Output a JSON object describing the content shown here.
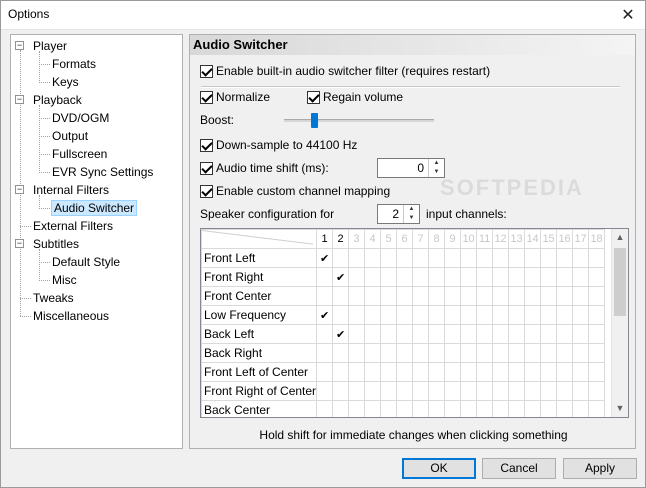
{
  "window": {
    "title": "Options",
    "close_glyph": "✕"
  },
  "tree": {
    "items": [
      {
        "label": "Player",
        "level": 0,
        "expand": "−"
      },
      {
        "label": "Formats",
        "level": 1
      },
      {
        "label": "Keys",
        "level": 1
      },
      {
        "label": "Playback",
        "level": 0,
        "expand": "−"
      },
      {
        "label": "DVD/OGM",
        "level": 1
      },
      {
        "label": "Output",
        "level": 1
      },
      {
        "label": "Fullscreen",
        "level": 1
      },
      {
        "label": "EVR Sync Settings",
        "level": 1
      },
      {
        "label": "Internal Filters",
        "level": 0,
        "expand": "−"
      },
      {
        "label": "Audio Switcher",
        "level": 1,
        "selected": true
      },
      {
        "label": "External Filters",
        "level": 0
      },
      {
        "label": "Subtitles",
        "level": 0,
        "expand": "−"
      },
      {
        "label": "Default Style",
        "level": 1
      },
      {
        "label": "Misc",
        "level": 1
      },
      {
        "label": "Tweaks",
        "level": 0
      },
      {
        "label": "Miscellaneous",
        "level": 0
      }
    ]
  },
  "panel": {
    "header": "Audio Switcher",
    "enable_filter": {
      "label": "Enable built-in audio switcher filter (requires restart)",
      "checked": true
    },
    "normalize": {
      "label": "Normalize",
      "checked": true
    },
    "regain_volume": {
      "label": "Regain volume",
      "checked": true
    },
    "boost": {
      "label": "Boost:",
      "level": 0.2
    },
    "downsample": {
      "label": "Down-sample to 44100 Hz",
      "checked": true
    },
    "time_shift": {
      "label": "Audio time shift (ms):",
      "checked": true,
      "value": "0"
    },
    "custom_mapping": {
      "label": "Enable custom channel mapping",
      "checked": true
    },
    "speaker_config": {
      "label": "Speaker configuration for",
      "value": "2",
      "suffix": "input channels:"
    },
    "watermark": "SOFTPEDIA",
    "grid": {
      "channels": [
        "1",
        "2",
        "3",
        "4",
        "5",
        "6",
        "7",
        "8",
        "9",
        "10",
        "11",
        "12",
        "13",
        "14",
        "15",
        "16",
        "17",
        "18"
      ],
      "active_channels": 2,
      "rows": [
        {
          "label": "Front Left",
          "check_col": 0
        },
        {
          "label": "Front Right",
          "check_col": 1
        },
        {
          "label": "Front Center",
          "check_col": -1
        },
        {
          "label": "Low Frequency",
          "check_col": 0
        },
        {
          "label": "Back Left",
          "check_col": 1
        },
        {
          "label": "Back Right",
          "check_col": -1
        },
        {
          "label": "Front Left of Center",
          "check_col": -1
        },
        {
          "label": "Front Right of Center",
          "check_col": -1
        },
        {
          "label": "Back Center",
          "check_col": -1
        }
      ],
      "check_glyph": "✔"
    },
    "hint": "Hold shift for immediate changes when clicking something"
  },
  "buttons": {
    "ok": "OK",
    "cancel": "Cancel",
    "apply": "Apply"
  }
}
